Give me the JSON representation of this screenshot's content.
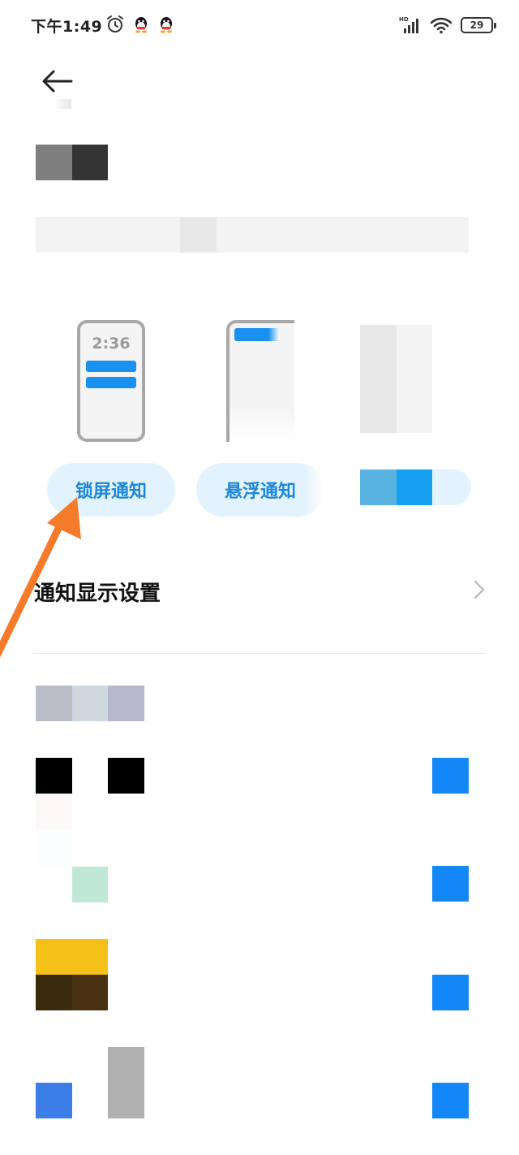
{
  "status_bar": {
    "time": "下午1:49",
    "icons": [
      "alarm-icon",
      "qq-icon",
      "qq-icon"
    ],
    "network": "HD",
    "battery": "29"
  },
  "header": {
    "back_icon": "back-arrow-icon"
  },
  "notification_styles": {
    "lock_screen": {
      "label": "锁屏通知",
      "clock": "2:36"
    },
    "floating": {
      "label": "悬浮通知"
    }
  },
  "settings": {
    "display_settings_label": "通知显示设置",
    "chevron_icon": "chevron-right-icon"
  },
  "apps": [
    {
      "toggle": "on"
    },
    {
      "toggle": "on"
    },
    {
      "toggle": "on"
    },
    {
      "toggle": "on"
    }
  ],
  "colors": {
    "accent": "#1487f8",
    "pill_bg": "#e3f3fd",
    "pill_text": "#1c87d9",
    "annotation": "#f57a2a"
  }
}
